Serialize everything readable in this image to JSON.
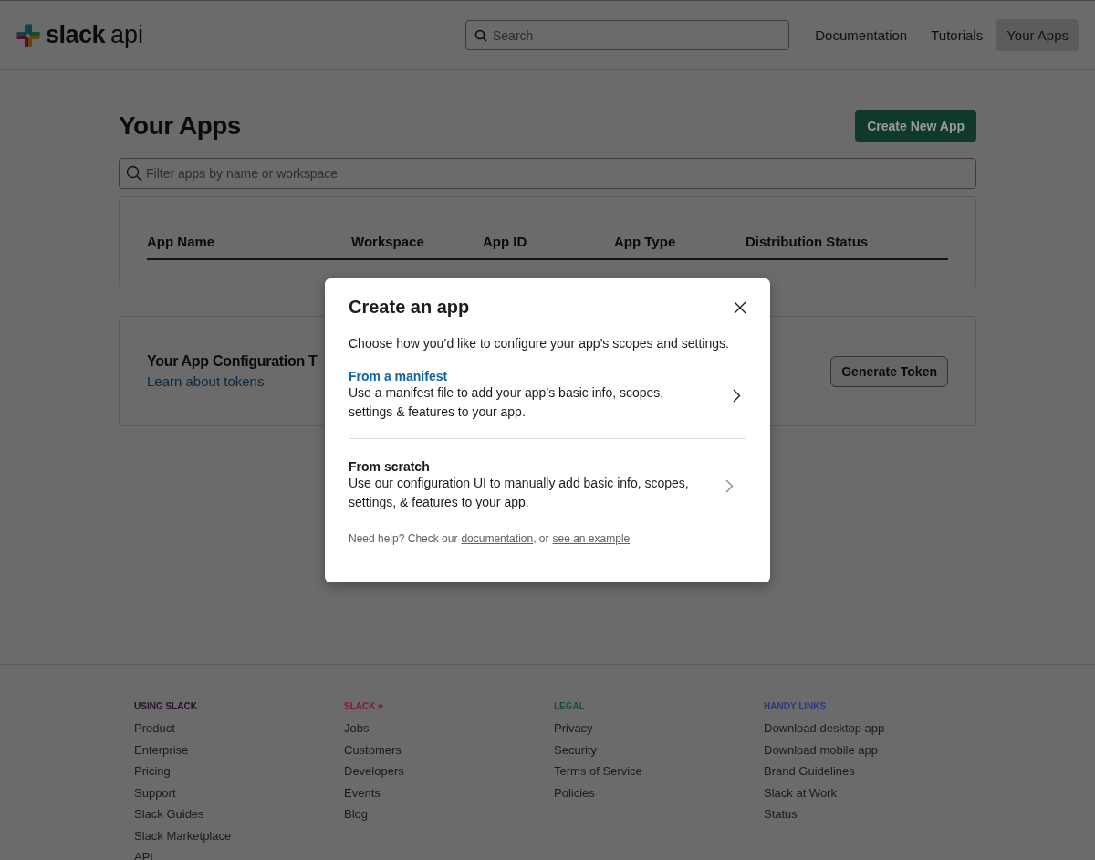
{
  "header": {
    "logo": {
      "brand": "slack",
      "suffix": "api"
    },
    "search": {
      "placeholder": "Search"
    },
    "nav": [
      {
        "label": "Documentation",
        "selected": false
      },
      {
        "label": "Tutorials",
        "selected": false
      },
      {
        "label": "Your Apps",
        "selected": true
      }
    ]
  },
  "page": {
    "title": "Your Apps",
    "create_button": "Create New App",
    "filter": {
      "placeholder": "Filter apps by name or workspace"
    },
    "table": {
      "columns": [
        "App Name",
        "Workspace",
        "App ID",
        "App Type",
        "Distribution Status"
      ]
    },
    "token_card": {
      "title": "Your App Configuration T",
      "link": "Learn about tokens",
      "button": "Generate Token"
    }
  },
  "modal": {
    "title": "Create an app",
    "intro": "Choose how you’d like to configure your app’s scopes and settings.",
    "options": [
      {
        "title": "From a manifest",
        "description": "Use a manifest file to add your app’s basic info, scopes, settings & features to your app.",
        "highlighted": true
      },
      {
        "title": "From scratch",
        "description": "Use our configuration UI to manually add basic info, scopes, settings, & features to your app.",
        "highlighted": false
      }
    ],
    "help": {
      "text": "Need help? Check our",
      "link1": "documentation",
      "between": ", or",
      "link2": "see an example"
    }
  },
  "footer": {
    "columns": [
      {
        "heading": "USING SLACK",
        "color": "#2a0f2c",
        "links": [
          "Product",
          "Enterprise",
          "Pricing",
          "Support",
          "Slack Guides",
          "Slack Marketplace",
          "API"
        ]
      },
      {
        "heading": "SLACK ♥",
        "color": "#7a1a3a",
        "links": [
          "Jobs",
          "Customers",
          "Developers",
          "Events",
          "Blog"
        ]
      },
      {
        "heading": "LEGAL",
        "color": "#1f4d3a",
        "links": [
          "Privacy",
          "Security",
          "Terms of Service",
          "Policies"
        ]
      },
      {
        "heading": "HANDY LINKS",
        "color": "#2a3a7a",
        "links": [
          "Download desktop app",
          "Download mobile app",
          "Brand Guidelines",
          "Slack at Work",
          "Status"
        ]
      }
    ]
  }
}
